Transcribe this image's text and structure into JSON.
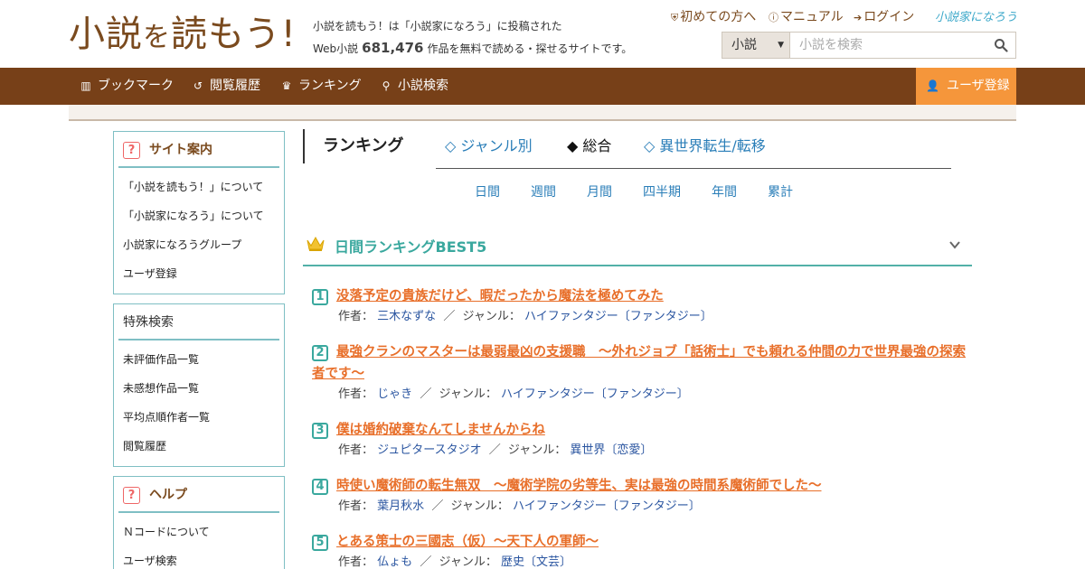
{
  "header": {
    "logo": {
      "part1": "小説",
      "part2": "を",
      "part3": "読もう!"
    },
    "description_line1": "小説を読もう！は「小説家になろう」に投稿された",
    "description_prefix": "Web小説",
    "work_count": "681,476",
    "description_suffix": "作品を無料で読める・探せるサイトです。",
    "links": [
      {
        "label": "初めての方へ",
        "icon": "shield-icon"
      },
      {
        "label": "マニュアル",
        "icon": "question-circle-icon"
      },
      {
        "label": "ログイン",
        "icon": "login-icon"
      }
    ],
    "partner_logo": "小説家になろう",
    "search": {
      "select_value": "小説",
      "placeholder": "小説を検索"
    }
  },
  "nav": {
    "items": [
      {
        "label": "ブックマーク",
        "icon": "bookmark-icon"
      },
      {
        "label": "閲覧履歴",
        "icon": "history-icon"
      },
      {
        "label": "ランキング",
        "icon": "crown-icon"
      },
      {
        "label": "小説検索",
        "icon": "search-icon"
      }
    ],
    "register_label": "ユーザ登録"
  },
  "sidebar": {
    "site_guide": {
      "title": "サイト案内",
      "items": [
        "「小説を読もう！」について",
        "「小説家になろう」について",
        "小説家になろうグループ",
        "ユーザ登録"
      ]
    },
    "special_search": {
      "title": "特殊検索",
      "items": [
        "未評価作品一覧",
        "未感想作品一覧",
        "平均点順作者一覧",
        "閲覧履歴"
      ]
    },
    "help": {
      "title": "ヘルプ",
      "items": [
        "Ｎコードについて",
        "ユーザ検索"
      ]
    }
  },
  "ranking": {
    "title": "ランキング",
    "category_tabs": [
      {
        "label": "◇ ジャンル別",
        "active": false
      },
      {
        "label": "◆ 総合",
        "active": true
      },
      {
        "label": "◇ 異世界転生/転移",
        "active": false
      }
    ],
    "period_tabs": [
      "日間",
      "週間",
      "月間",
      "四半期",
      "年間",
      "累計"
    ],
    "best_title": "日間ランキングBEST5",
    "author_label": "作者：",
    "genre_label": "ジャンル：",
    "separator": "／",
    "entries": [
      {
        "rank": "1",
        "title": "没落予定の貴族だけど、暇だったから魔法を極めてみた",
        "author": "三木なずな",
        "genre": "ハイファンタジー〔ファンタジー〕"
      },
      {
        "rank": "2",
        "title": "最強クランのマスターは最弱最凶の支援職　～外れジョブ「話術士」でも頼れる仲間の力で世界最強の探索者です～",
        "author": "じゃき",
        "genre": "ハイファンタジー〔ファンタジー〕"
      },
      {
        "rank": "3",
        "title": "僕は婚約破棄なんてしませんからね",
        "author": "ジュピタースタジオ",
        "genre": "異世界〔恋愛〕"
      },
      {
        "rank": "4",
        "title": "時使い魔術師の転生無双　～魔術学院の劣等生、実は最強の時間系魔術師でした～",
        "author": "葉月秋水",
        "genre": "ハイファンタジー〔ファンタジー〕"
      },
      {
        "rank": "5",
        "title": "とある策士の三國志（仮）～天下人の軍師～",
        "author": "仏ょも",
        "genre": "歴史〔文芸〕"
      }
    ]
  },
  "colors": {
    "brand_brown": "#774018",
    "accent_orange": "#f5963b",
    "link_blue": "#2a7eb8",
    "title_orange": "#e86f2a",
    "teal": "#3aa89e"
  }
}
